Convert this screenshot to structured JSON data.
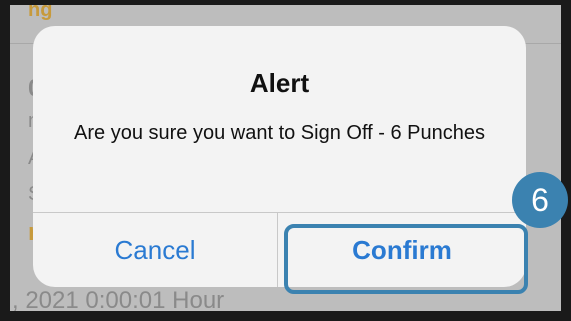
{
  "background": {
    "rows": [
      {
        "text": "ng",
        "style": "orange"
      },
      {
        "text": "0,"
      },
      {
        "text": "m"
      },
      {
        "text": "A"
      },
      {
        "text": "Si"
      },
      {
        "text": "n",
        "style": "orange"
      },
      {
        "text": ", 2021 0:00:01 Hour"
      }
    ]
  },
  "alert": {
    "title": "Alert",
    "message": "Are you sure you want to Sign Off - 6 Punches",
    "cancel_label": "Cancel",
    "confirm_label": "Confirm"
  },
  "tutorial": {
    "step_number": "6",
    "accent_color": "#3b82b0"
  },
  "colors": {
    "button_text": "#2a7ad2",
    "alert_background": "#f3f3f3",
    "overlay": "#bdbdbd"
  }
}
